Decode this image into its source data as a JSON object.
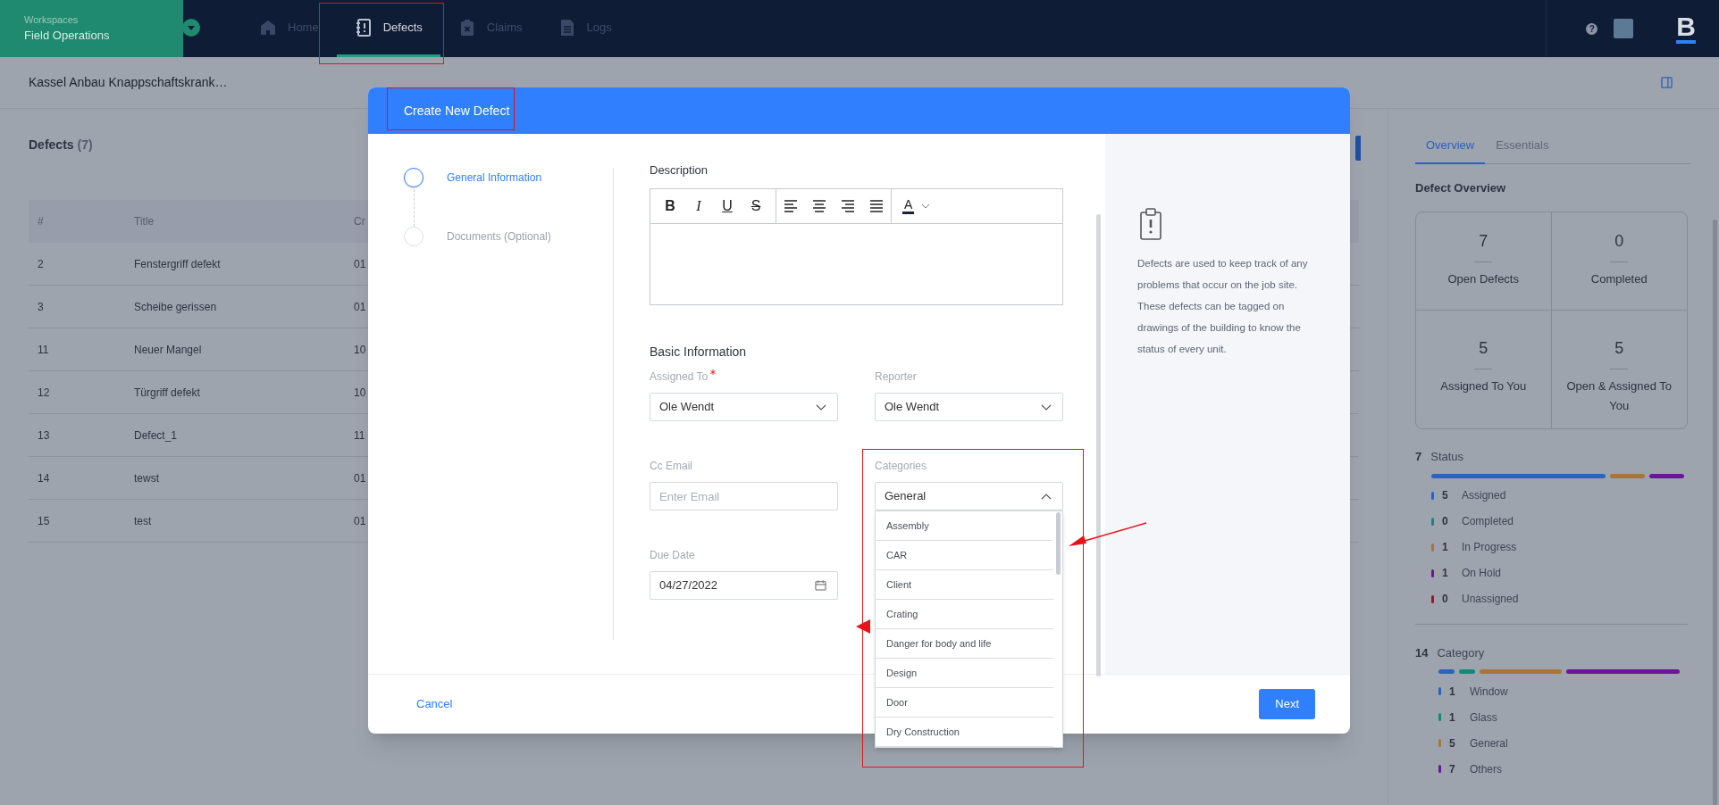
{
  "top_nav": {
    "workspace_label": "Workspaces",
    "workspace_name": "Field Operations",
    "tabs": [
      {
        "label": "Home",
        "selected": false
      },
      {
        "label": "Defects",
        "selected": true
      },
      {
        "label": "Claims",
        "selected": false
      },
      {
        "label": "Logs",
        "selected": false
      }
    ],
    "help": "?",
    "logo": "B"
  },
  "subheader": {
    "project_title": "Kassel Anbau Knappschaftskrank…"
  },
  "defects_list": {
    "title": "Defects",
    "count": "(7)",
    "columns": [
      "#",
      "Title",
      "Cr"
    ],
    "rows": [
      [
        "2",
        "Fenstergriff defekt",
        "01"
      ],
      [
        "3",
        "Scheibe gerissen",
        "01"
      ],
      [
        "11",
        "Neuer Mangel",
        "10"
      ],
      [
        "12",
        "Türgriff defekt",
        "10"
      ],
      [
        "13",
        "Defect_1",
        "11"
      ],
      [
        "14",
        "tewst",
        "01"
      ],
      [
        "15",
        "test",
        "01"
      ]
    ]
  },
  "modal": {
    "title": "Create New Defect",
    "steps": [
      {
        "label": "General Information",
        "selected": true
      },
      {
        "label": "Documents (Optional)",
        "selected": false
      }
    ],
    "description": {
      "label": "Description",
      "format_buttons": [
        "B",
        "I",
        "U",
        "S"
      ],
      "text_color_button": "A"
    },
    "basic_information": {
      "heading": "Basic Information",
      "assigned_to": {
        "label": "Assigned To",
        "required": true,
        "value": "Ole Wendt"
      },
      "reporter": {
        "label": "Reporter",
        "value": "Ole Wendt"
      },
      "cc_email": {
        "label": "Cc Email",
        "placeholder": "Enter Email"
      },
      "categories": {
        "label": "Categories",
        "value": "General",
        "expanded": true,
        "options": [
          "Assembly",
          "CAR",
          "Client",
          "Crating",
          "Danger for body and life",
          "Design",
          "Door",
          "Dry Construction"
        ]
      },
      "due_date": {
        "label": "Due Date",
        "value": "04/27/2022"
      }
    },
    "info_text": "Defects are used to keep track of any problems that occur on the job site. These defects can be tagged on drawings of the building to know the status of every unit.",
    "cancel_button": "Cancel",
    "next_button": "Next"
  },
  "overview_panel": {
    "tabs": [
      {
        "label": "Overview",
        "selected": true
      },
      {
        "label": "Essentials",
        "selected": false
      }
    ],
    "heading": "Defect Overview",
    "stats": [
      {
        "value": "7",
        "label": "Open Defects"
      },
      {
        "value": "0",
        "label": "Completed"
      },
      {
        "value": "5",
        "label": "Assigned To You"
      },
      {
        "value": "5",
        "label": "Open & Assigned To You"
      }
    ],
    "status": {
      "total": "7",
      "title": "Status",
      "items": [
        {
          "count": "5",
          "label": "Assigned",
          "color": "#2a63c2"
        },
        {
          "count": "0",
          "label": "Completed",
          "color": "#14897a"
        },
        {
          "count": "1",
          "label": "In Progress",
          "color": "#a87538"
        },
        {
          "count": "1",
          "label": "On Hold",
          "color": "#6b159c"
        },
        {
          "count": "0",
          "label": "Unassigned",
          "color": "#8c1f2c"
        }
      ]
    },
    "category": {
      "total": "14",
      "title": "Category",
      "items": [
        {
          "count": "1",
          "label": "Window",
          "color": "#2a63c2"
        },
        {
          "count": "1",
          "label": "Glass",
          "color": "#14897a"
        },
        {
          "count": "5",
          "label": "General",
          "color": "#a87538"
        },
        {
          "count": "7",
          "label": "Others",
          "color": "#6b159c"
        }
      ]
    }
  }
}
